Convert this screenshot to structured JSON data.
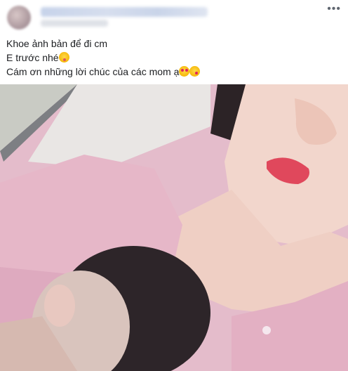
{
  "post": {
    "caption_lines": [
      "Khoe ảnh bản để đi cm",
      "E trước nhé",
      "Cám ơn những lời chúc của các mom ạ"
    ],
    "more_label": "•••"
  },
  "icons": {
    "line2_emoji": "winking-face-with-tongue-icon",
    "line3_emoji_1": "smiling-face-with-heart-eyes-icon",
    "line3_emoji_2": "face-blowing-kiss-icon"
  }
}
